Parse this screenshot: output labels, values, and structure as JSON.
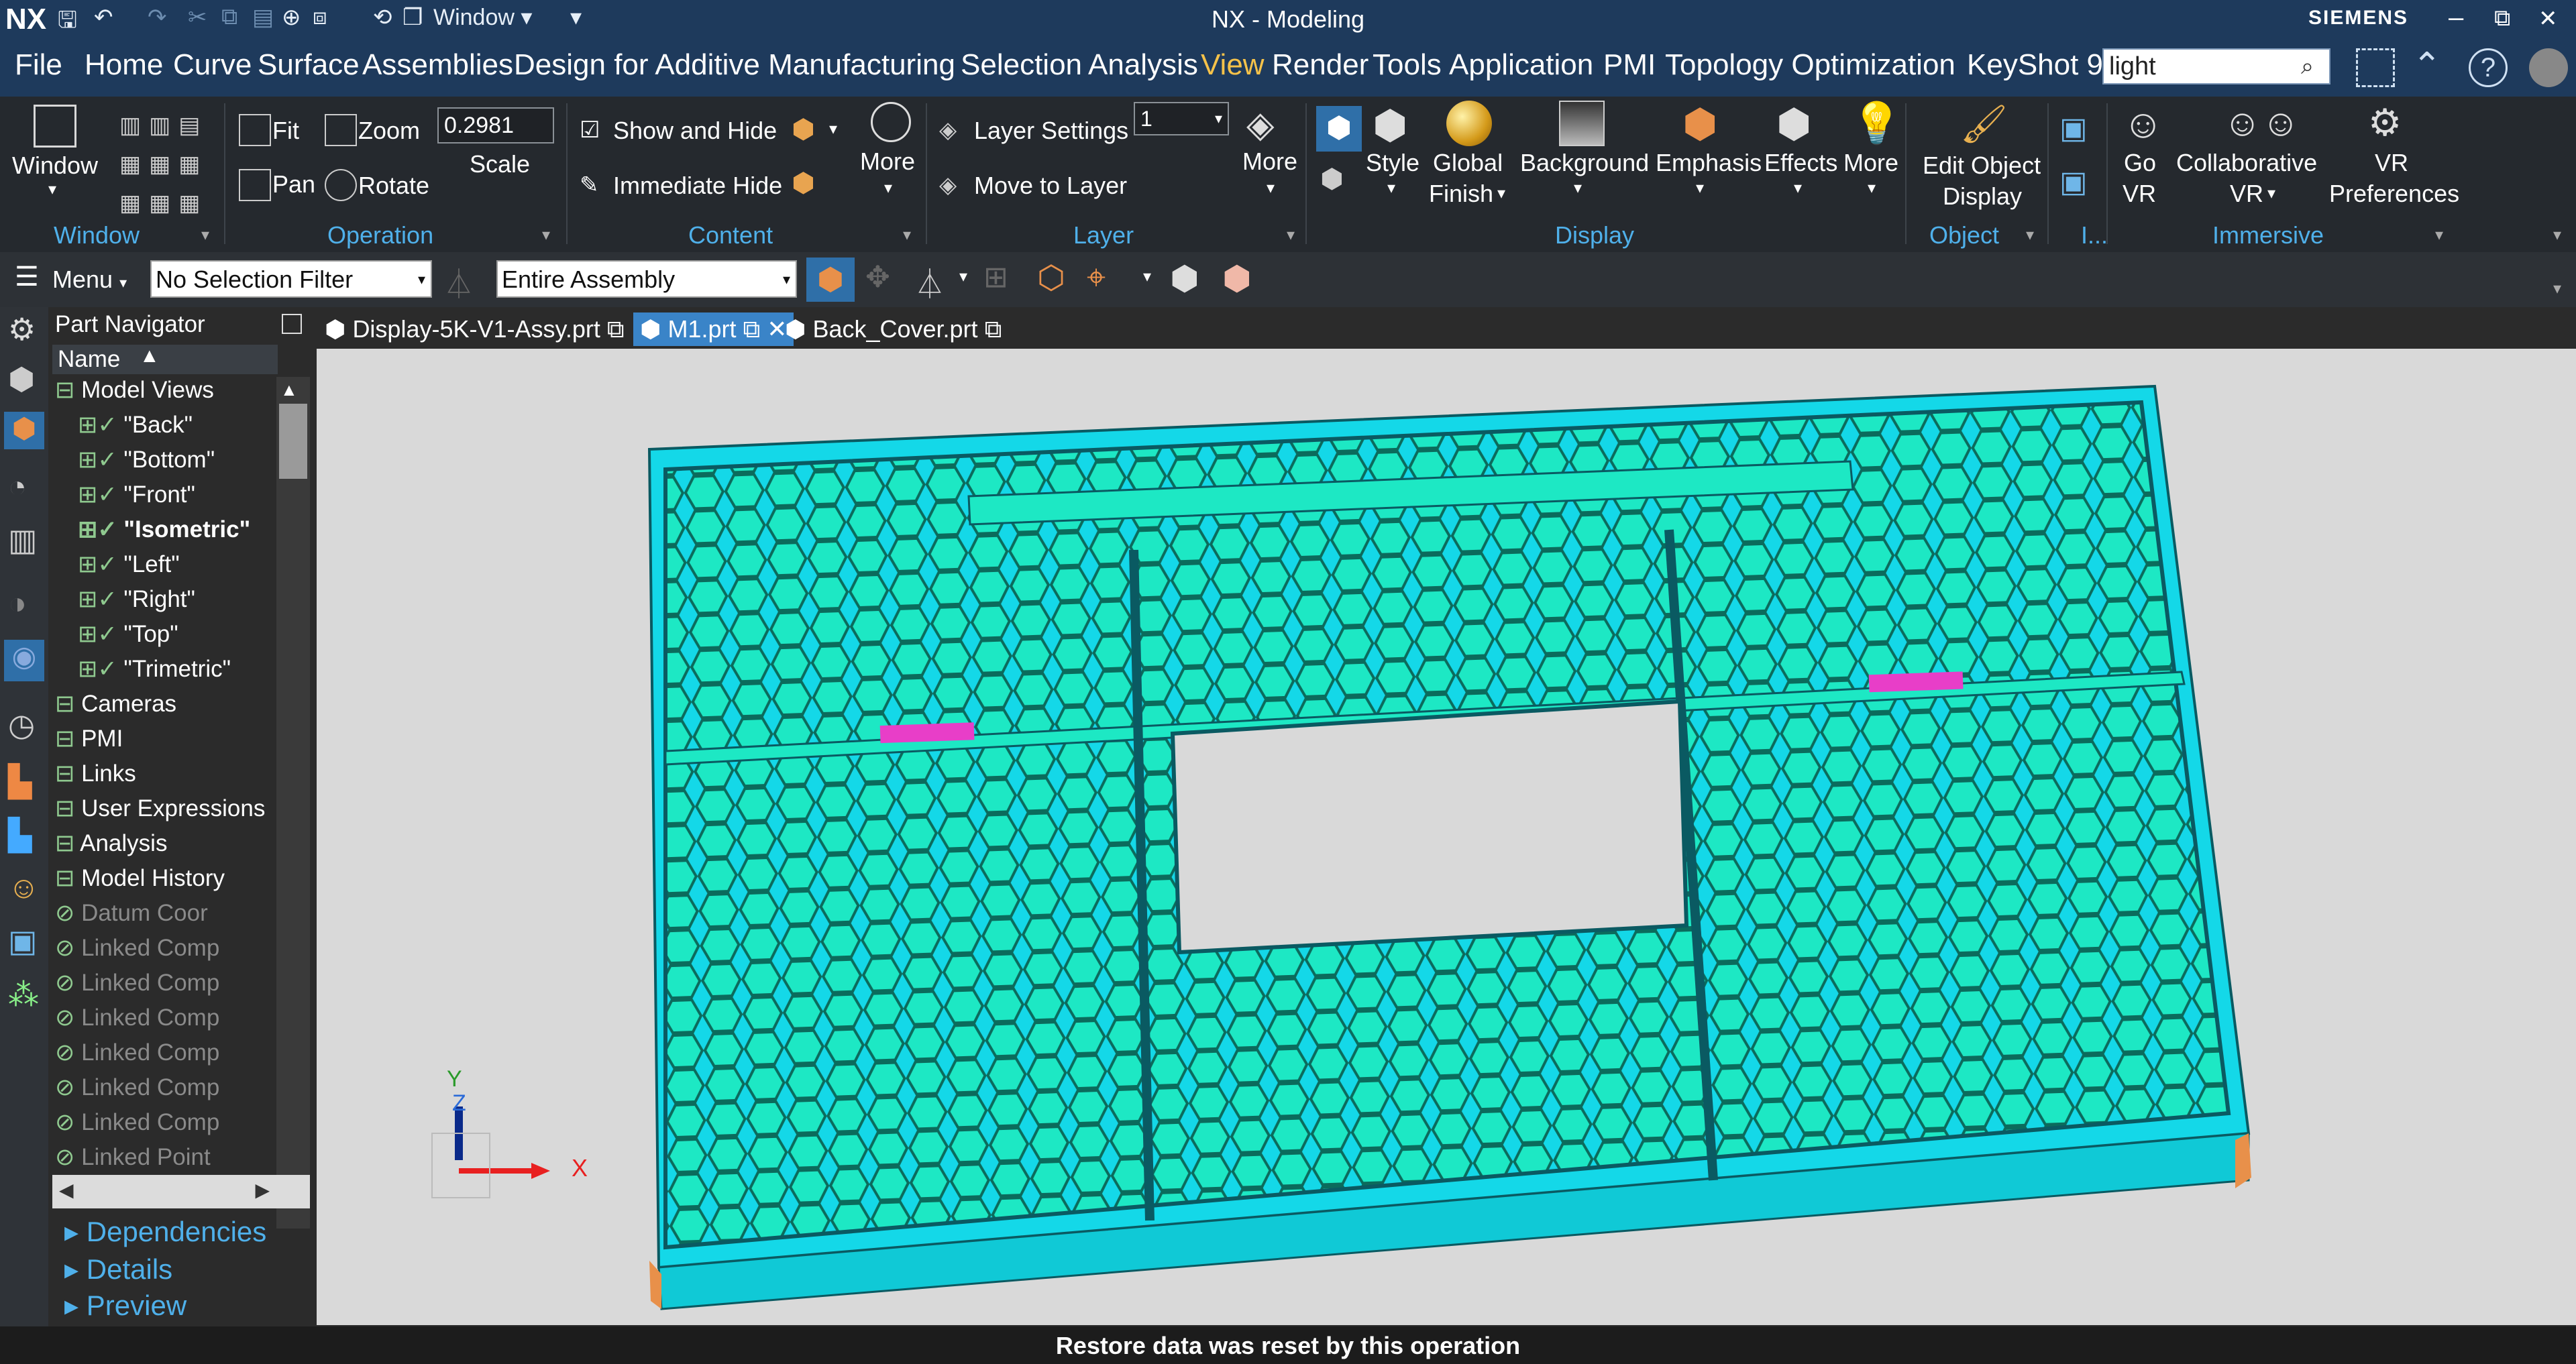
{
  "titlebar": {
    "app_logo": "NX",
    "title": "NX - Modeling",
    "brand": "SIEMENS",
    "window_menu": "Window",
    "controls": {
      "minimize": "–",
      "restore": "⧉",
      "close": "✕"
    }
  },
  "menubar": {
    "items": [
      "File",
      "Home",
      "Curve",
      "Surface",
      "Assemblies",
      "Design for Additive Manufacturing",
      "Selection",
      "Analysis",
      "View",
      "Render",
      "Tools",
      "Application",
      "PMI",
      "Topology Optimization",
      "KeyShot 9"
    ],
    "active": "View",
    "search_value": "light"
  },
  "ribbon": {
    "window": {
      "label": "Window",
      "group": "Window"
    },
    "operation": {
      "fit": "Fit",
      "zoom": "Zoom",
      "pan": "Pan",
      "rotate": "Rotate",
      "scale_value": "0.2981",
      "scale_label": "Scale",
      "group": "Operation"
    },
    "content": {
      "show_hide": "Show and Hide",
      "immediate_hide": "Immediate Hide",
      "more": "More",
      "group": "Content"
    },
    "layer": {
      "layer_settings": "Layer Settings",
      "move_to_layer": "Move to Layer",
      "layer_value": "1",
      "more": "More",
      "group": "Layer"
    },
    "display": {
      "style": "Style",
      "global": "Global",
      "finish": "Finish",
      "background": "Background",
      "emphasis": "Emphasis",
      "effects": "Effects",
      "more": "More",
      "group": "Display"
    },
    "object": {
      "edit_object": "Edit Object",
      "display": "Display",
      "group": "Object",
      "group2": "I..."
    },
    "immersive": {
      "go": "Go",
      "vr": "VR",
      "collaborative": "Collaborative",
      "collab_vr": "VR",
      "vr2": "VR",
      "preferences": "Preferences",
      "group": "Immersive"
    }
  },
  "toolrow": {
    "menu": "Menu",
    "selection_filter": "No Selection Filter",
    "scope": "Entire Assembly"
  },
  "navigator": {
    "title": "Part Navigator",
    "column": "Name",
    "rows": [
      {
        "label": "Model Views",
        "dim": false,
        "bold": false
      },
      {
        "label": "\"Back\"",
        "dim": false,
        "bold": false
      },
      {
        "label": "\"Bottom\"",
        "dim": false,
        "bold": false
      },
      {
        "label": "\"Front\"",
        "dim": false,
        "bold": false
      },
      {
        "label": "\"Isometric\"",
        "dim": false,
        "bold": true
      },
      {
        "label": "\"Left\"",
        "dim": false,
        "bold": false
      },
      {
        "label": "\"Right\"",
        "dim": false,
        "bold": false
      },
      {
        "label": "\"Top\"",
        "dim": false,
        "bold": false
      },
      {
        "label": "\"Trimetric\"",
        "dim": false,
        "bold": false
      },
      {
        "label": "Cameras",
        "dim": false,
        "bold": false
      },
      {
        "label": "PMI",
        "dim": false,
        "bold": false
      },
      {
        "label": "Links",
        "dim": false,
        "bold": false
      },
      {
        "label": "User Expressions",
        "dim": false,
        "bold": false
      },
      {
        "label": "Analysis",
        "dim": false,
        "bold": false
      },
      {
        "label": "Model History",
        "dim": false,
        "bold": false
      },
      {
        "label": "Datum Coor",
        "dim": true,
        "bold": false
      },
      {
        "label": "Linked Comp",
        "dim": true,
        "bold": false
      },
      {
        "label": "Linked Comp",
        "dim": true,
        "bold": false
      },
      {
        "label": "Linked Comp",
        "dim": true,
        "bold": false
      },
      {
        "label": "Linked Comp",
        "dim": true,
        "bold": false
      },
      {
        "label": "Linked Comp",
        "dim": true,
        "bold": false
      },
      {
        "label": "Linked Comp",
        "dim": true,
        "bold": false
      },
      {
        "label": "Linked Point",
        "dim": true,
        "bold": false
      }
    ],
    "panels": [
      "Dependencies",
      "Details",
      "Preview"
    ]
  },
  "tabs": [
    {
      "label": "Display-5K-V1-Assy.prt",
      "active": false
    },
    {
      "label": "M1.prt",
      "active": true
    },
    {
      "label": "Back_Cover.prt",
      "active": false
    }
  ],
  "triad": {
    "x": "X",
    "y": "Y",
    "z": "Z"
  },
  "colors": {
    "titlebar": "#1e3a5c",
    "accent": "#f5c24a",
    "part": "#1de8c4",
    "rim": "#14d8e8",
    "magenta": "#e83ec8",
    "viewport": "#d9d9d9"
  },
  "status": "Restore data was reset by this operation"
}
